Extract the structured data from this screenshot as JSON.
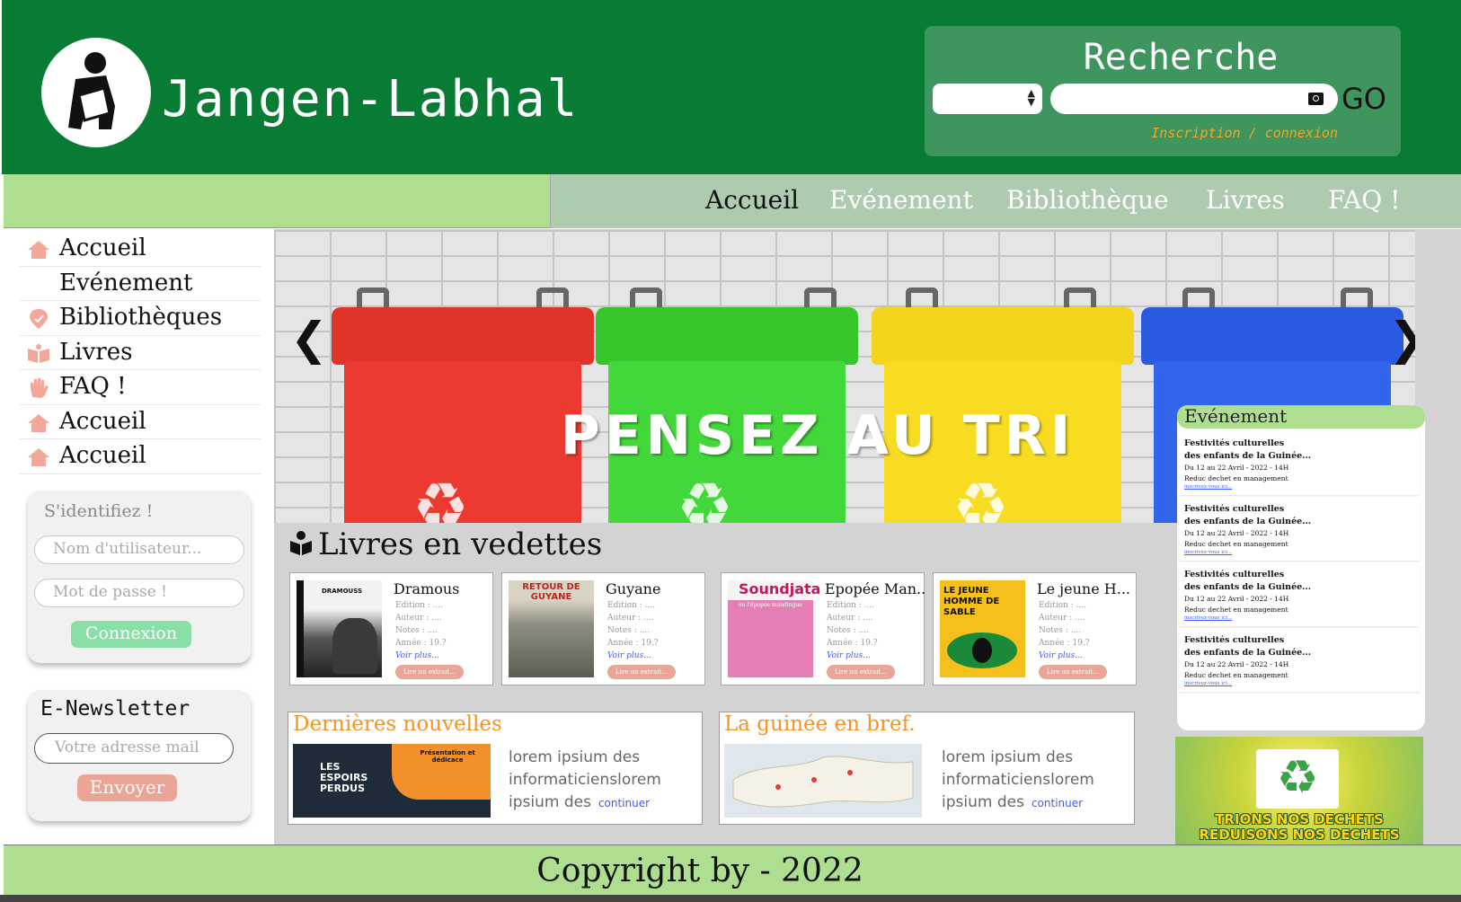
{
  "colors": {
    "header_green": "#087b34",
    "search_panel": "#3e955d",
    "nav_light_green": "#aedf90",
    "nav_grey_green": "#aecaaf",
    "accent_orange": "#f5a623",
    "button_salmon": "#e9a595",
    "button_mint": "#88e0a6",
    "link_blue": "#3d5afe"
  },
  "header": {
    "site_title": "Jangen-Labhal",
    "logo_icon": "reading-person-icon",
    "search": {
      "title": "Recherche",
      "category_select_value": "",
      "query_value": "",
      "go_label": "GO",
      "auth_link": "Inscription / connexion"
    }
  },
  "nav": {
    "items": [
      "Accueil",
      "Evénement",
      "Bibliothèque",
      "Livres",
      "FAQ !"
    ],
    "active": "Accueil"
  },
  "sidebar": {
    "items": [
      {
        "label": "Accueil",
        "icon": "home-icon"
      },
      {
        "label": "Evénement",
        "icon": ""
      },
      {
        "label": "Bibliothèques",
        "icon": "location-pin-icon"
      },
      {
        "label": "Livres",
        "icon": "open-book-icon"
      },
      {
        "label": "FAQ !",
        "icon": "hand-icon"
      },
      {
        "label": "Accueil",
        "icon": "home-icon"
      },
      {
        "label": "Accueil",
        "icon": "home-icon"
      }
    ],
    "login": {
      "title": "S'identifiez !",
      "username_placeholder": "Nom d'utilisateur...",
      "password_placeholder": "Mot de passe !",
      "submit_label": "Connexion"
    },
    "newsletter": {
      "title": "E-Newsletter",
      "email_placeholder": "Votre adresse mail",
      "submit_label": "Envoyer"
    }
  },
  "carousel": {
    "caption": "PENSEZ AU TRI",
    "prev": "❮",
    "next": "❯",
    "recycle_symbol": "♻"
  },
  "featured": {
    "title": "Livres en vedettes",
    "icon": "book-reader-icon",
    "books": [
      {
        "title": "Dramous",
        "cover_text": "DRAMOUSS",
        "edition": "Edition : ....",
        "author": "Auteur : ....",
        "notes": "Notes   : ....",
        "year": "Année  : 19.?",
        "more": "Voir plus...",
        "excerpt": "Lire un extrait..."
      },
      {
        "title": "Guyane",
        "cover_text": "RETOUR DE GUYANE",
        "edition": "Edition : ....",
        "author": "Auteur : ....",
        "notes": "Notes   : ....",
        "year": "Année  : 19.?",
        "more": "Voir plus...",
        "excerpt": "Lire un extrait..."
      },
      {
        "title": "Epopée Man..",
        "cover_text": "Soundjata",
        "cover_sub": "ou l'épopée mandingue",
        "edition": "Edition : ....",
        "author": "Auteur : ....",
        "notes": "Notes   : ....",
        "year": "Année  : 19.?",
        "more": "Voir plus...",
        "excerpt": "Lire un extrait..."
      },
      {
        "title": "Le jeune H...",
        "cover_text": "LE JEUNE HOMME DE SABLE",
        "edition": "Edition : ....",
        "author": "Auteur : ....",
        "notes": "Notes   : ....",
        "year": "Année  : 19.?",
        "more": "Voir plus...",
        "excerpt": "Lire un extrait..."
      }
    ]
  },
  "news": {
    "latest": {
      "title": "Dernières nouvelles",
      "image_text": "LES ESPOIRS PERDUS",
      "image_badge": "Présentation et dédicace",
      "text": "lorem ipsium des informaticienslorem ipsium des",
      "more": "continuer"
    },
    "guinea": {
      "title": "La guinée en bref.",
      "text": "lorem ipsium des informaticienslorem ipsium des",
      "more": "continuer"
    }
  },
  "events": {
    "title": "Evénement",
    "items": [
      {
        "title1": "Festivités culturelles",
        "title2": "des enfants de la Guinée...",
        "date": "Du 12 au 22 Avril - 2022 - 14H",
        "desc": "Reduc dechet en management",
        "link": "inscrivez-vous ici..."
      },
      {
        "title1": "Festivités culturelles",
        "title2": "des enfants de la Guinée...",
        "date": "Du 12 au 22 Avril - 2022 - 14H",
        "desc": "Reduc dechet en management",
        "link": "inscrivez-vous ici..."
      },
      {
        "title1": "Festivités culturelles",
        "title2": "des enfants de la Guinée...",
        "date": "Du 12 au 22 Avril - 2022 - 14H",
        "desc": "Reduc dechet en management",
        "link": "inscrivez-vous ici..."
      },
      {
        "title1": "Festivités culturelles",
        "title2": "des enfants de la Guinée...",
        "date": "Du 12 au 22 Avril - 2022 - 14H",
        "desc": "Reduc dechet en management",
        "link": "inscrivez-vous ici..."
      }
    ]
  },
  "promo": {
    "line1": "TRIONS NOS DECHETS",
    "line2": "REDUISONS NOS DECHETS"
  },
  "footer": {
    "text": "Copyright by - 2022"
  }
}
